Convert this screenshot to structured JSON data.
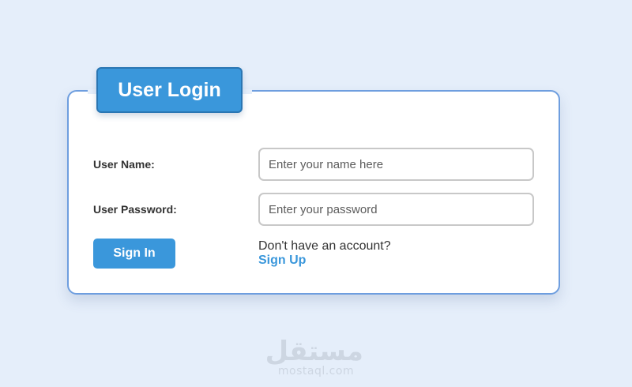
{
  "login": {
    "title": "User Login",
    "username_label": "User Name:",
    "username_placeholder": "Enter your name here",
    "password_label": "User Password:",
    "password_placeholder": "Enter your password",
    "signin_label": "Sign In",
    "no_account_text": "Don't have an account?",
    "signup_label": "Sign Up"
  },
  "watermark": {
    "logo_text": "مستقل",
    "url_text": "mostaql.com"
  },
  "colors": {
    "background": "#e5eefa",
    "accent": "#3a97db",
    "card_border": "#6e9edf",
    "input_border": "#c8c8c8"
  }
}
